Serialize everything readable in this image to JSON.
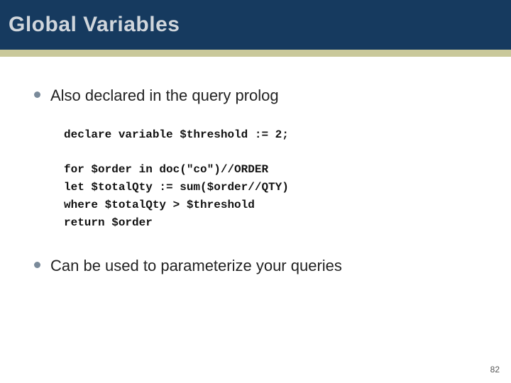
{
  "title": "Global Variables",
  "bullets": {
    "b1": "Also declared in the query prolog",
    "b2": "Can be used to parameterize your queries"
  },
  "code": {
    "decl": "declare variable $threshold := 2;",
    "l1": "for $order in doc(\"co\")//ORDER",
    "l2": "let $totalQty := sum($order//QTY)",
    "l3": "where $totalQty > $threshold",
    "l4": "return $order"
  },
  "slide_number": "82"
}
